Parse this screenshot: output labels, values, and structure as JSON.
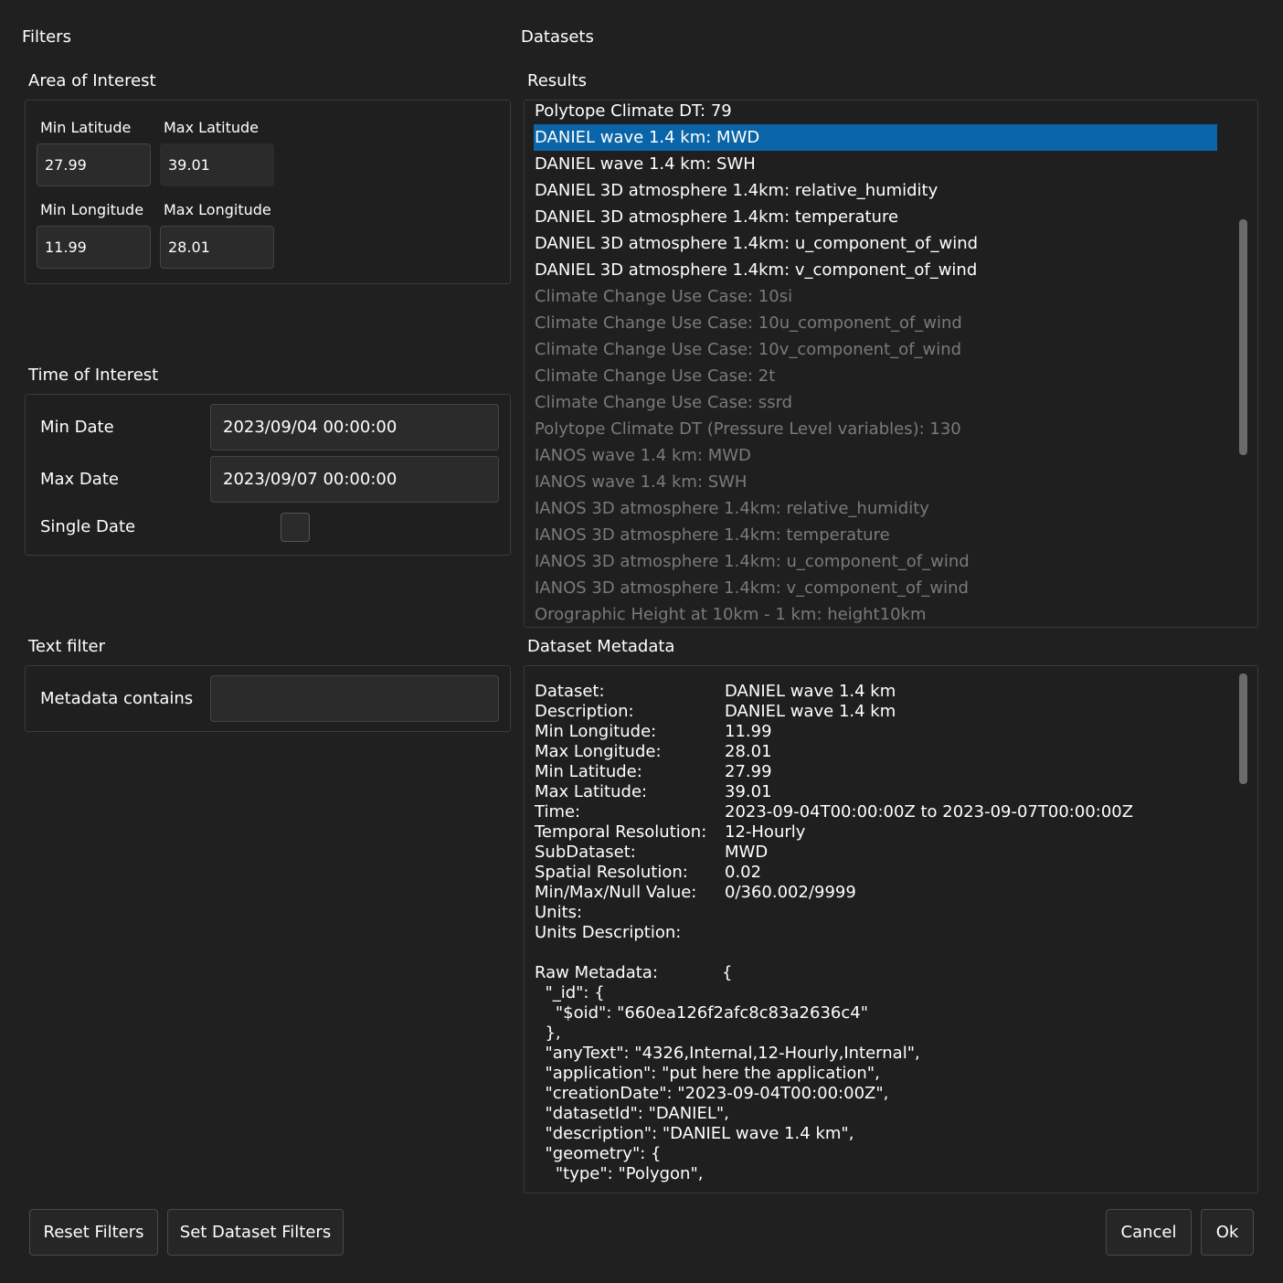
{
  "filters": {
    "title": "Filters",
    "area": {
      "title": "Area of Interest",
      "min_lat_label": "Min Latitude",
      "max_lat_label": "Max Latitude",
      "min_lon_label": "Min Longitude",
      "max_lon_label": "Max Longitude",
      "min_lat": "27.99",
      "max_lat": "39.01",
      "min_lon": "11.99",
      "max_lon": "28.01"
    },
    "time": {
      "title": "Time of Interest",
      "min_date_label": "Min Date",
      "min_date": "2023/09/04 00:00:00",
      "max_date_label": "Max Date",
      "max_date": "2023/09/07 00:00:00",
      "single_date_label": "Single Date",
      "single_date_checked": false
    },
    "text": {
      "title": "Text filter",
      "metadata_label": "Metadata contains",
      "metadata_value": ""
    }
  },
  "datasets": {
    "title": "Datasets",
    "results_title": "Results",
    "results": [
      "Polytope Climate DT: 79",
      "DANIEL wave 1.4 km: MWD",
      "DANIEL wave 1.4 km: SWH",
      "DANIEL 3D atmosphere 1.4km: relative_humidity",
      "DANIEL 3D atmosphere 1.4km: temperature",
      "DANIEL 3D atmosphere 1.4km: u_component_of_wind",
      "DANIEL 3D atmosphere 1.4km: v_component_of_wind",
      "Climate Change Use Case: 10si",
      "Climate Change Use Case: 10u_component_of_wind",
      "Climate Change Use Case: 10v_component_of_wind",
      "Climate Change Use Case: 2t",
      "Climate Change Use Case: ssrd",
      "Polytope Climate DT (Pressure Level variables): 130",
      "IANOS wave 1.4 km: MWD",
      "IANOS wave 1.4 km: SWH",
      "IANOS 3D atmosphere 1.4km: relative_humidity",
      "IANOS 3D atmosphere 1.4km: temperature",
      "IANOS 3D atmosphere 1.4km: u_component_of_wind",
      "IANOS 3D atmosphere 1.4km: v_component_of_wind",
      "Orographic Height at 10km - 1 km: height10km"
    ],
    "selected_index": 1,
    "enabled_count": 7,
    "metadata_title": "Dataset Metadata",
    "metadata": [
      {
        "label": "Dataset:",
        "value": "DANIEL wave 1.4 km"
      },
      {
        "label": "Description:",
        "value": "DANIEL wave 1.4 km"
      },
      {
        "label": "Min  Longitude:",
        "value": "11.99"
      },
      {
        "label": "Max Longitude:",
        "value": "28.01"
      },
      {
        "label": "Min  Latitude:",
        "value": "27.99"
      },
      {
        "label": "Max Latitude:",
        "value": "39.01"
      },
      {
        "label": "Time:",
        "value": "2023-09-04T00:00:00Z to 2023-09-07T00:00:00Z"
      },
      {
        "label": "Temporal Resolution:",
        "value": "12-Hourly"
      },
      {
        "label": "SubDataset:",
        "value": "MWD"
      },
      {
        "label": "Spatial Resolution:",
        "value": "0.02"
      },
      {
        "label": "Min/Max/Null Value:",
        "value": "0/360.002/9999"
      },
      {
        "label": "Units:",
        "value": ""
      },
      {
        "label": "Units Description:",
        "value": ""
      }
    ],
    "raw_label": "Raw Metadata:",
    "raw_open": "{",
    "raw_lines": [
      "  \"_id\": {",
      "    \"$oid\": \"660ea126f2afc8c83a2636c4\"",
      "  },",
      "  \"anyText\": \"4326,Internal,12-Hourly,Internal\",",
      "  \"application\": \"put here the application\",",
      "  \"creationDate\": \"2023-09-04T00:00:00Z\",",
      "  \"datasetId\": \"DANIEL\",",
      "  \"description\": \"DANIEL wave 1.4 km\",",
      "  \"geometry\": {",
      "    \"type\": \"Polygon\","
    ]
  },
  "buttons": {
    "reset": "Reset Filters",
    "set_dataset": "Set Dataset Filters",
    "cancel": "Cancel",
    "ok": "Ok"
  }
}
